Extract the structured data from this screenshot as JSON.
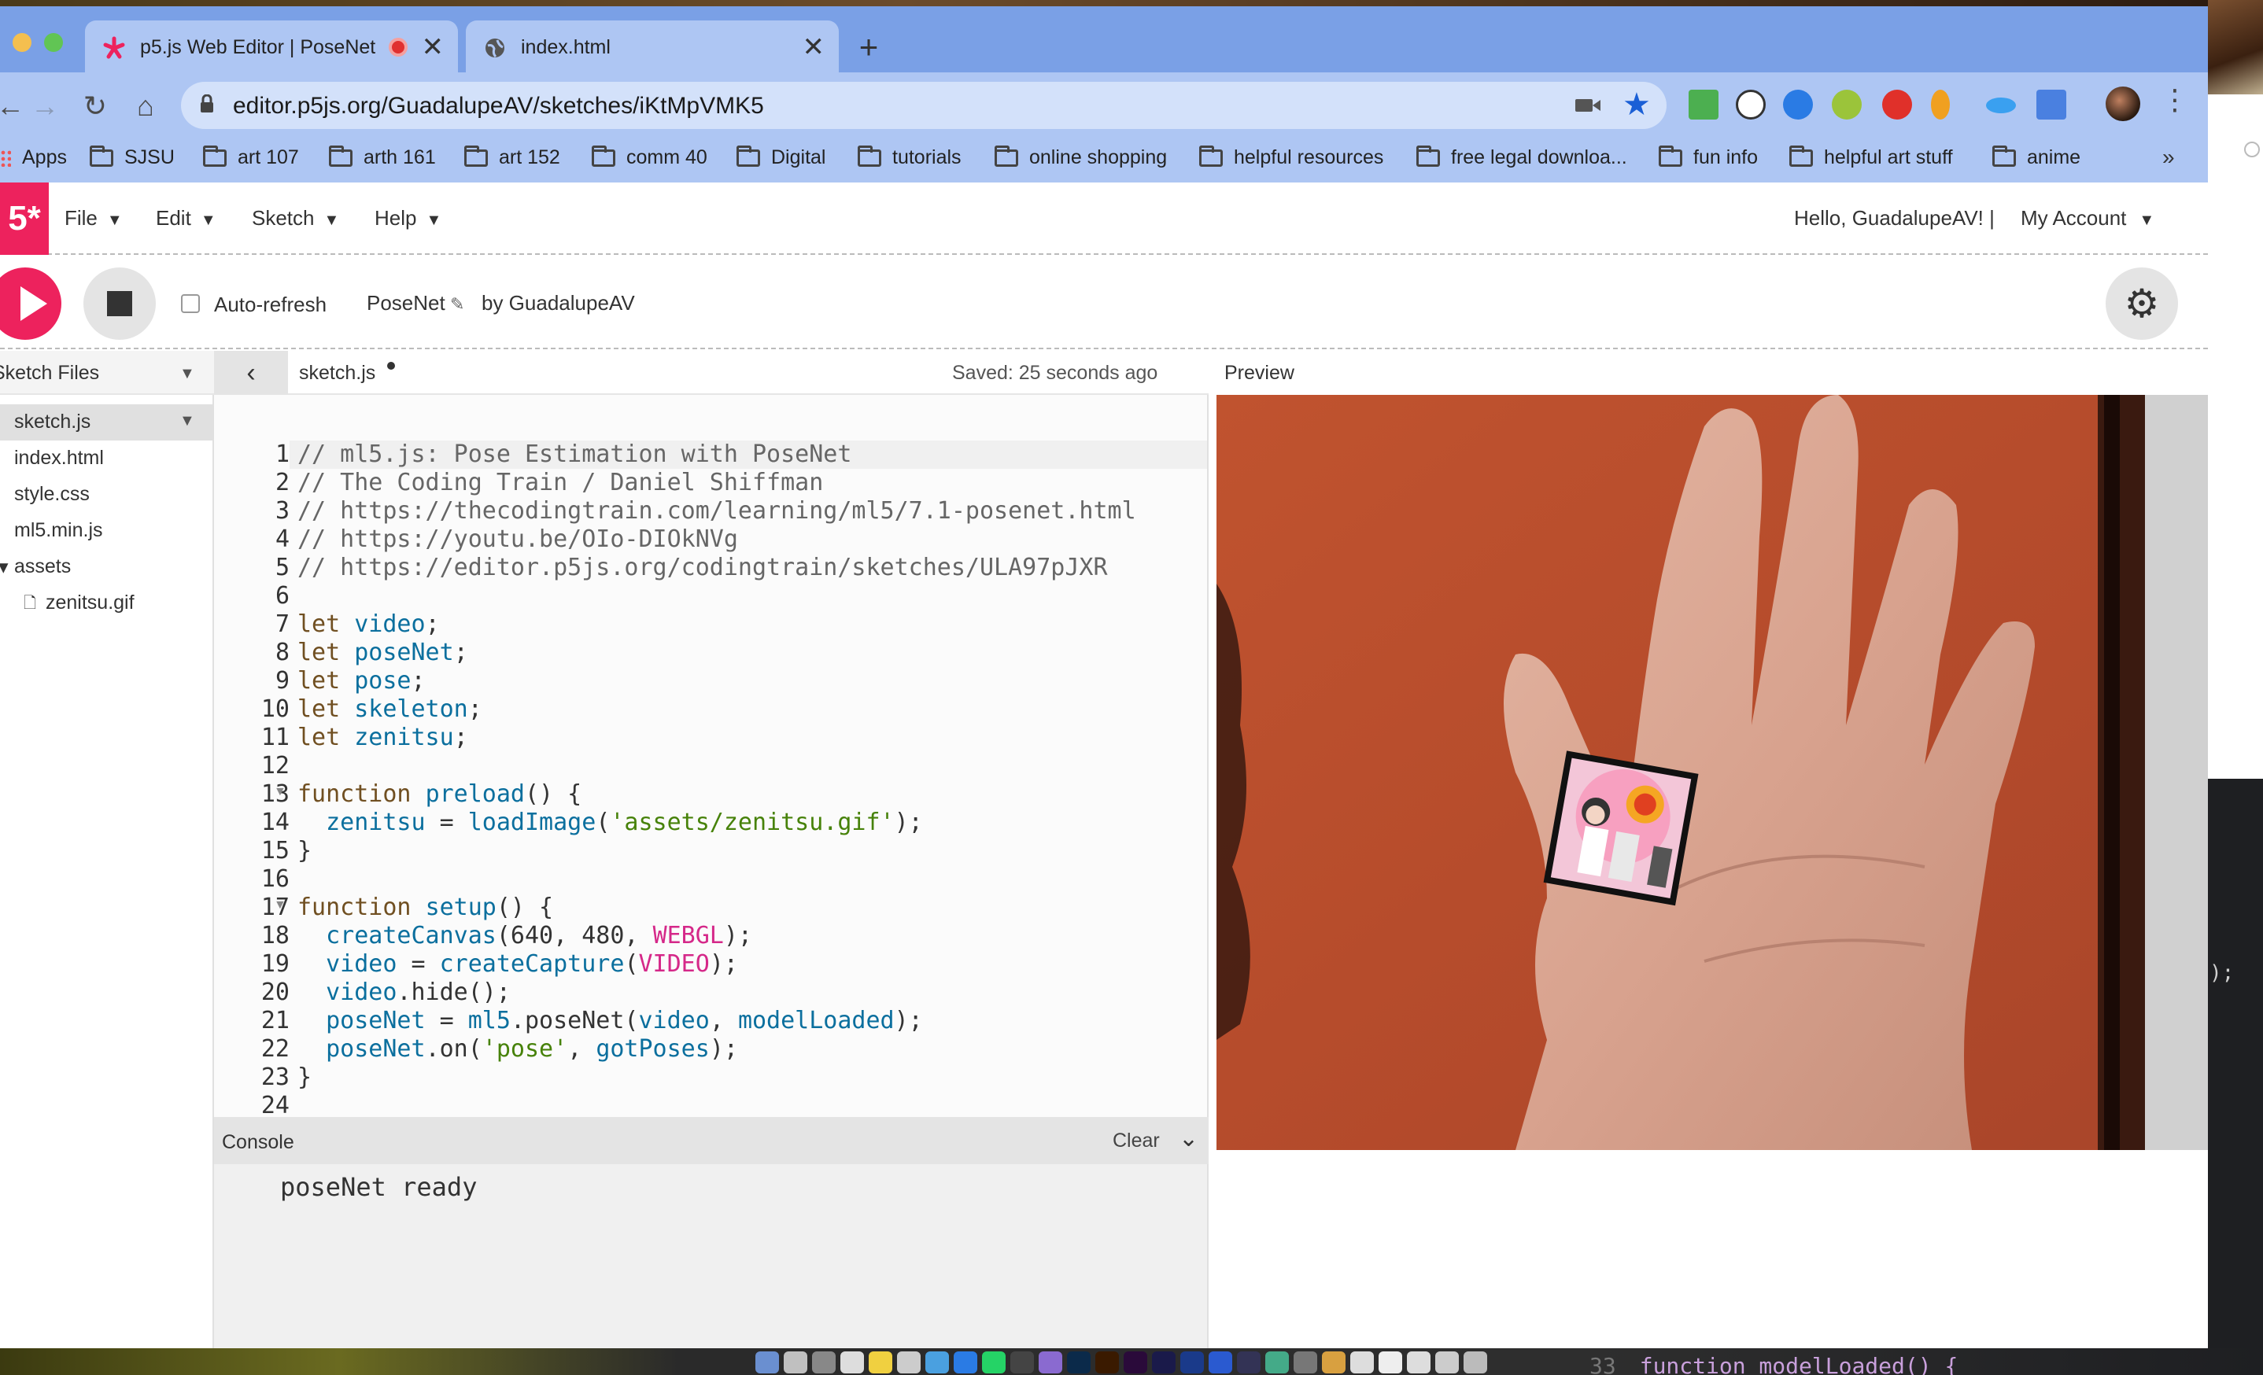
{
  "browser": {
    "tabs": [
      {
        "title": "p5.js Web Editor | PoseNet",
        "close": "✕"
      },
      {
        "title": "index.html",
        "close": "✕"
      }
    ],
    "new_tab": "+",
    "url": "editor.p5js.org/GuadalupeAV/sketches/iKtMpVMK5",
    "menu_icon": "⋮",
    "bookmarks": [
      {
        "label": "Apps"
      },
      {
        "label": "SJSU"
      },
      {
        "label": "art 107"
      },
      {
        "label": "arth 161"
      },
      {
        "label": "art 152"
      },
      {
        "label": "comm 40"
      },
      {
        "label": "Digital"
      },
      {
        "label": "tutorials"
      },
      {
        "label": "online shopping"
      },
      {
        "label": "helpful resources"
      },
      {
        "label": "free legal downloa..."
      },
      {
        "label": "fun info"
      },
      {
        "label": "helpful art stuff"
      },
      {
        "label": "anime"
      }
    ],
    "bookmarks_more": "»"
  },
  "editor_nav": {
    "logo": "5*",
    "menus": [
      "File",
      "Edit",
      "Sketch",
      "Help"
    ],
    "hello": "Hello, GuadalupeAV!  |",
    "account": "My Account"
  },
  "sketch_toolbar": {
    "auto_refresh_label": "Auto-refresh",
    "auto_refresh_checked": false,
    "project_name": "PoseNet",
    "author": "by GuadalupeAV"
  },
  "sidebar": {
    "title": "Sketch Files",
    "files": [
      {
        "name": "sketch.js",
        "active": true
      },
      {
        "name": "index.html"
      },
      {
        "name": "style.css"
      },
      {
        "name": "ml5.min.js"
      },
      {
        "name": "assets",
        "folder": true
      },
      {
        "name": "zenitsu.gif",
        "indent": true
      }
    ]
  },
  "editor": {
    "filename": "sketch.js",
    "saved_status": "Saved: 25 seconds ago",
    "line_numbers": [
      "1",
      "2",
      "3",
      "4",
      "5",
      "6",
      "7",
      "8",
      "9",
      "10",
      "11",
      "12",
      "13",
      "14",
      "15",
      "16",
      "17",
      "18",
      "19",
      "20",
      "21",
      "22",
      "23",
      "24"
    ],
    "folded_lines": [
      "13",
      "17"
    ]
  },
  "console": {
    "title": "Console",
    "clear_label": "Clear",
    "messages": [
      "poseNet ready"
    ]
  },
  "preview": {
    "title": "Preview"
  },
  "background_window": {
    "code_right": ");",
    "code_bottom_line_num": "33",
    "code_bottom": "function modelLoaded() {"
  },
  "colors": {
    "p5_accent": "#ed225d",
    "tabstrip": "#7aa0e6",
    "chrome_toolbar": "#aec6f3"
  }
}
